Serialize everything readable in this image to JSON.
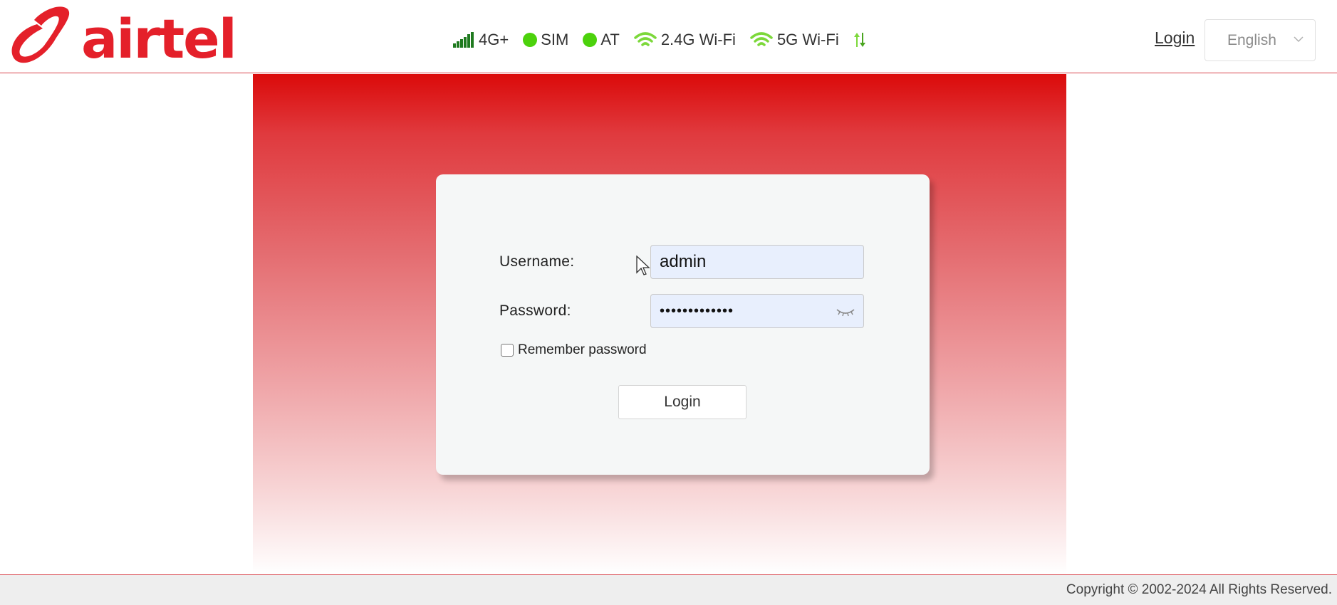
{
  "header": {
    "brand": "airtel",
    "status": {
      "network": "4G+",
      "sim": "SIM",
      "at": "AT",
      "wifi_24": "2.4G Wi-Fi",
      "wifi_5": "5G Wi-Fi"
    },
    "login_link": "Login",
    "language": "English"
  },
  "login_form": {
    "username_label": "Username:",
    "username_value": "admin",
    "password_label": "Password:",
    "password_value": "•••••••••••••",
    "remember_label": "Remember password",
    "remember_checked": false,
    "submit_label": "Login"
  },
  "footer": {
    "copyright": "Copyright © 2002-2024 All Rights Reserved."
  },
  "colors": {
    "brand_red": "#e4202a",
    "status_green": "#4cd20c",
    "wifi_green": "#7cd83a"
  }
}
